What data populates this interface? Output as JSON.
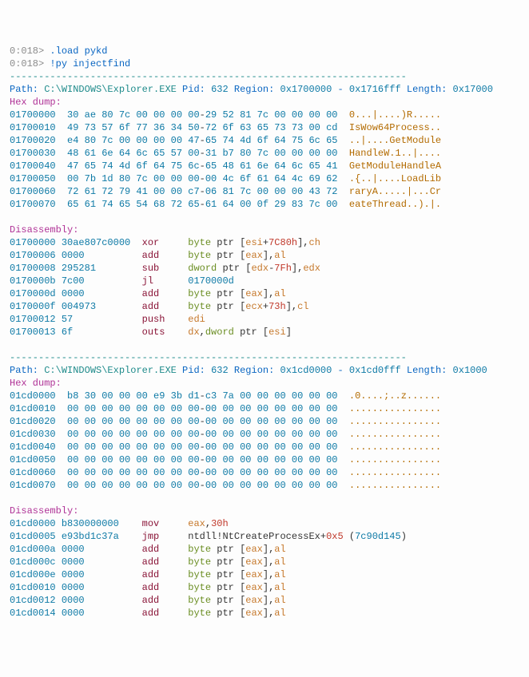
{
  "prompt1": {
    "p": "0:018>",
    "c": " .load pykd"
  },
  "prompt2": {
    "p": "0:018>",
    "c": " !py injectfind"
  },
  "rule": "---------------------------------------------------------------------",
  "r1": {
    "label_path": "Path: ",
    "path": "C:\\WINDOWS\\Explorer.EXE",
    "label_pid": " Pid: ",
    "pid": "632",
    "label_reg": " Region: ",
    "rstart": "0x1700000",
    "dash": " - ",
    "rend": "0x1716fff",
    "label_len": " Length: ",
    "len": "0x17000",
    "hexdump_label": "Hex dump:",
    "hex": [
      {
        "a": "01700000",
        "l": "30 ae 80 7c 00 00 00 00",
        "r": "29 52 81 7c 00 00 00 00",
        "t": "  0...|....)R....."
      },
      {
        "a": "01700010",
        "l": "49 73 57 6f 77 36 34 50",
        "r": "72 6f 63 65 73 73 00 cd",
        "t": "  IsWow64Process.."
      },
      {
        "a": "01700020",
        "l": "e4 80 7c 00 00 00 00 47",
        "r": "65 74 4d 6f 64 75 6c 65",
        "t": "  ..|....GetModule"
      },
      {
        "a": "01700030",
        "l": "48 61 6e 64 6c 65 57 00",
        "r": "31 b7 80 7c 00 00 00 00",
        "t": "  HandleW.1..|...."
      },
      {
        "a": "01700040",
        "l": "47 65 74 4d 6f 64 75 6c",
        "r": "65 48 61 6e 64 6c 65 41",
        "t": "  GetModuleHandleA"
      },
      {
        "a": "01700050",
        "l": "00 7b 1d 80 7c 00 00 00",
        "r": "00 4c 6f 61 64 4c 69 62",
        "t": "  .{..|....LoadLib"
      },
      {
        "a": "01700060",
        "l": "72 61 72 79 41 00 00 c7",
        "r": "06 81 7c 00 00 00 43 72",
        "t": "  raryA.....|...Cr"
      },
      {
        "a": "01700070",
        "l": "65 61 74 65 54 68 72 65",
        "r": "61 64 00 0f 29 83 7c 00",
        "t": "  eateThread..).|."
      }
    ],
    "dis_label": "Disassembly:",
    "dis": [
      {
        "a": "01700000",
        "b": "30ae807c0000",
        "m": "xor",
        "op": [
          {
            "t": "byte",
            "c": "olive"
          },
          {
            "t": " ptr [",
            "c": "dk"
          },
          {
            "t": "esi",
            "c": "orange"
          },
          {
            "t": "+",
            "c": "dk"
          },
          {
            "t": "7C80h",
            "c": "red"
          },
          {
            "t": "],",
            "c": "dk"
          },
          {
            "t": "ch",
            "c": "orange"
          }
        ]
      },
      {
        "a": "01700006",
        "b": "0000",
        "m": "add",
        "op": [
          {
            "t": "byte",
            "c": "olive"
          },
          {
            "t": " ptr [",
            "c": "dk"
          },
          {
            "t": "eax",
            "c": "orange"
          },
          {
            "t": "],",
            "c": "dk"
          },
          {
            "t": "al",
            "c": "orange"
          }
        ]
      },
      {
        "a": "01700008",
        "b": "295281",
        "m": "sub",
        "op": [
          {
            "t": "dword",
            "c": "olive"
          },
          {
            "t": " ptr [",
            "c": "dk"
          },
          {
            "t": "edx",
            "c": "orange"
          },
          {
            "t": "-",
            "c": "dk"
          },
          {
            "t": "7Fh",
            "c": "red"
          },
          {
            "t": "],",
            "c": "dk"
          },
          {
            "t": "edx",
            "c": "orange"
          }
        ]
      },
      {
        "a": "0170000b",
        "b": "7c00",
        "m": "jl",
        "op": [
          {
            "t": "0170000d",
            "c": "num"
          }
        ]
      },
      {
        "a": "0170000d",
        "b": "0000",
        "m": "add",
        "op": [
          {
            "t": "byte",
            "c": "olive"
          },
          {
            "t": " ptr [",
            "c": "dk"
          },
          {
            "t": "eax",
            "c": "orange"
          },
          {
            "t": "],",
            "c": "dk"
          },
          {
            "t": "al",
            "c": "orange"
          }
        ]
      },
      {
        "a": "0170000f",
        "b": "004973",
        "m": "add",
        "op": [
          {
            "t": "byte",
            "c": "olive"
          },
          {
            "t": " ptr [",
            "c": "dk"
          },
          {
            "t": "ecx",
            "c": "orange"
          },
          {
            "t": "+",
            "c": "dk"
          },
          {
            "t": "73h",
            "c": "red"
          },
          {
            "t": "],",
            "c": "dk"
          },
          {
            "t": "cl",
            "c": "orange"
          }
        ]
      },
      {
        "a": "01700012",
        "b": "57",
        "m": "push",
        "op": [
          {
            "t": "edi",
            "c": "orange"
          }
        ]
      },
      {
        "a": "01700013",
        "b": "6f",
        "m": "outs",
        "op": [
          {
            "t": "dx",
            "c": "orange"
          },
          {
            "t": ",",
            "c": "dk"
          },
          {
            "t": "dword",
            "c": "olive"
          },
          {
            "t": " ptr [",
            "c": "dk"
          },
          {
            "t": "esi",
            "c": "orange"
          },
          {
            "t": "]",
            "c": "dk"
          }
        ]
      }
    ]
  },
  "r2": {
    "label_path": "Path: ",
    "path": "C:\\WINDOWS\\Explorer.EXE",
    "label_pid": " Pid: ",
    "pid": "632",
    "label_reg": " Region: ",
    "rstart": "0x1cd0000",
    "dash": " - ",
    "rend": "0x1cd0fff",
    "label_len": " Length: ",
    "len": "0x1000",
    "hexdump_label": "Hex dump:",
    "hex": [
      {
        "a": "01cd0000",
        "l": "b8 30 00 00 00 e9 3b d1",
        "r": "c3 7a 00 00 00 00 00 00",
        "t": "  .0....;..z......"
      },
      {
        "a": "01cd0010",
        "l": "00 00 00 00 00 00 00 00",
        "r": "00 00 00 00 00 00 00 00",
        "t": "  ................"
      },
      {
        "a": "01cd0020",
        "l": "00 00 00 00 00 00 00 00",
        "r": "00 00 00 00 00 00 00 00",
        "t": "  ................"
      },
      {
        "a": "01cd0030",
        "l": "00 00 00 00 00 00 00 00",
        "r": "00 00 00 00 00 00 00 00",
        "t": "  ................"
      },
      {
        "a": "01cd0040",
        "l": "00 00 00 00 00 00 00 00",
        "r": "00 00 00 00 00 00 00 00",
        "t": "  ................"
      },
      {
        "a": "01cd0050",
        "l": "00 00 00 00 00 00 00 00",
        "r": "00 00 00 00 00 00 00 00",
        "t": "  ................"
      },
      {
        "a": "01cd0060",
        "l": "00 00 00 00 00 00 00 00",
        "r": "00 00 00 00 00 00 00 00",
        "t": "  ................"
      },
      {
        "a": "01cd0070",
        "l": "00 00 00 00 00 00 00 00",
        "r": "00 00 00 00 00 00 00 00",
        "t": "  ................"
      }
    ],
    "dis_label": "Disassembly:",
    "dis": [
      {
        "a": "01cd0000",
        "b": "b830000000",
        "m": "mov",
        "op": [
          {
            "t": "eax",
            "c": "orange"
          },
          {
            "t": ",",
            "c": "dk"
          },
          {
            "t": "30h",
            "c": "red"
          }
        ]
      },
      {
        "a": "01cd0005",
        "b": "e93bd1c37a",
        "m": "jmp",
        "op": [
          {
            "t": "ntdll!NtCreateProcessEx+",
            "c": "dk"
          },
          {
            "t": "0x5",
            "c": "red"
          },
          {
            "t": " (",
            "c": "dk"
          },
          {
            "t": "7c90d145",
            "c": "num"
          },
          {
            "t": ")",
            "c": "dk"
          }
        ]
      },
      {
        "a": "01cd000a",
        "b": "0000",
        "m": "add",
        "op": [
          {
            "t": "byte",
            "c": "olive"
          },
          {
            "t": " ptr [",
            "c": "dk"
          },
          {
            "t": "eax",
            "c": "orange"
          },
          {
            "t": "],",
            "c": "dk"
          },
          {
            "t": "al",
            "c": "orange"
          }
        ]
      },
      {
        "a": "01cd000c",
        "b": "0000",
        "m": "add",
        "op": [
          {
            "t": "byte",
            "c": "olive"
          },
          {
            "t": " ptr [",
            "c": "dk"
          },
          {
            "t": "eax",
            "c": "orange"
          },
          {
            "t": "],",
            "c": "dk"
          },
          {
            "t": "al",
            "c": "orange"
          }
        ]
      },
      {
        "a": "01cd000e",
        "b": "0000",
        "m": "add",
        "op": [
          {
            "t": "byte",
            "c": "olive"
          },
          {
            "t": " ptr [",
            "c": "dk"
          },
          {
            "t": "eax",
            "c": "orange"
          },
          {
            "t": "],",
            "c": "dk"
          },
          {
            "t": "al",
            "c": "orange"
          }
        ]
      },
      {
        "a": "01cd0010",
        "b": "0000",
        "m": "add",
        "op": [
          {
            "t": "byte",
            "c": "olive"
          },
          {
            "t": " ptr [",
            "c": "dk"
          },
          {
            "t": "eax",
            "c": "orange"
          },
          {
            "t": "],",
            "c": "dk"
          },
          {
            "t": "al",
            "c": "orange"
          }
        ]
      },
      {
        "a": "01cd0012",
        "b": "0000",
        "m": "add",
        "op": [
          {
            "t": "byte",
            "c": "olive"
          },
          {
            "t": " ptr [",
            "c": "dk"
          },
          {
            "t": "eax",
            "c": "orange"
          },
          {
            "t": "],",
            "c": "dk"
          },
          {
            "t": "al",
            "c": "orange"
          }
        ]
      },
      {
        "a": "01cd0014",
        "b": "0000",
        "m": "add",
        "op": [
          {
            "t": "byte",
            "c": "olive"
          },
          {
            "t": " ptr [",
            "c": "dk"
          },
          {
            "t": "eax",
            "c": "orange"
          },
          {
            "t": "],",
            "c": "dk"
          },
          {
            "t": "al",
            "c": "orange"
          }
        ]
      }
    ]
  }
}
